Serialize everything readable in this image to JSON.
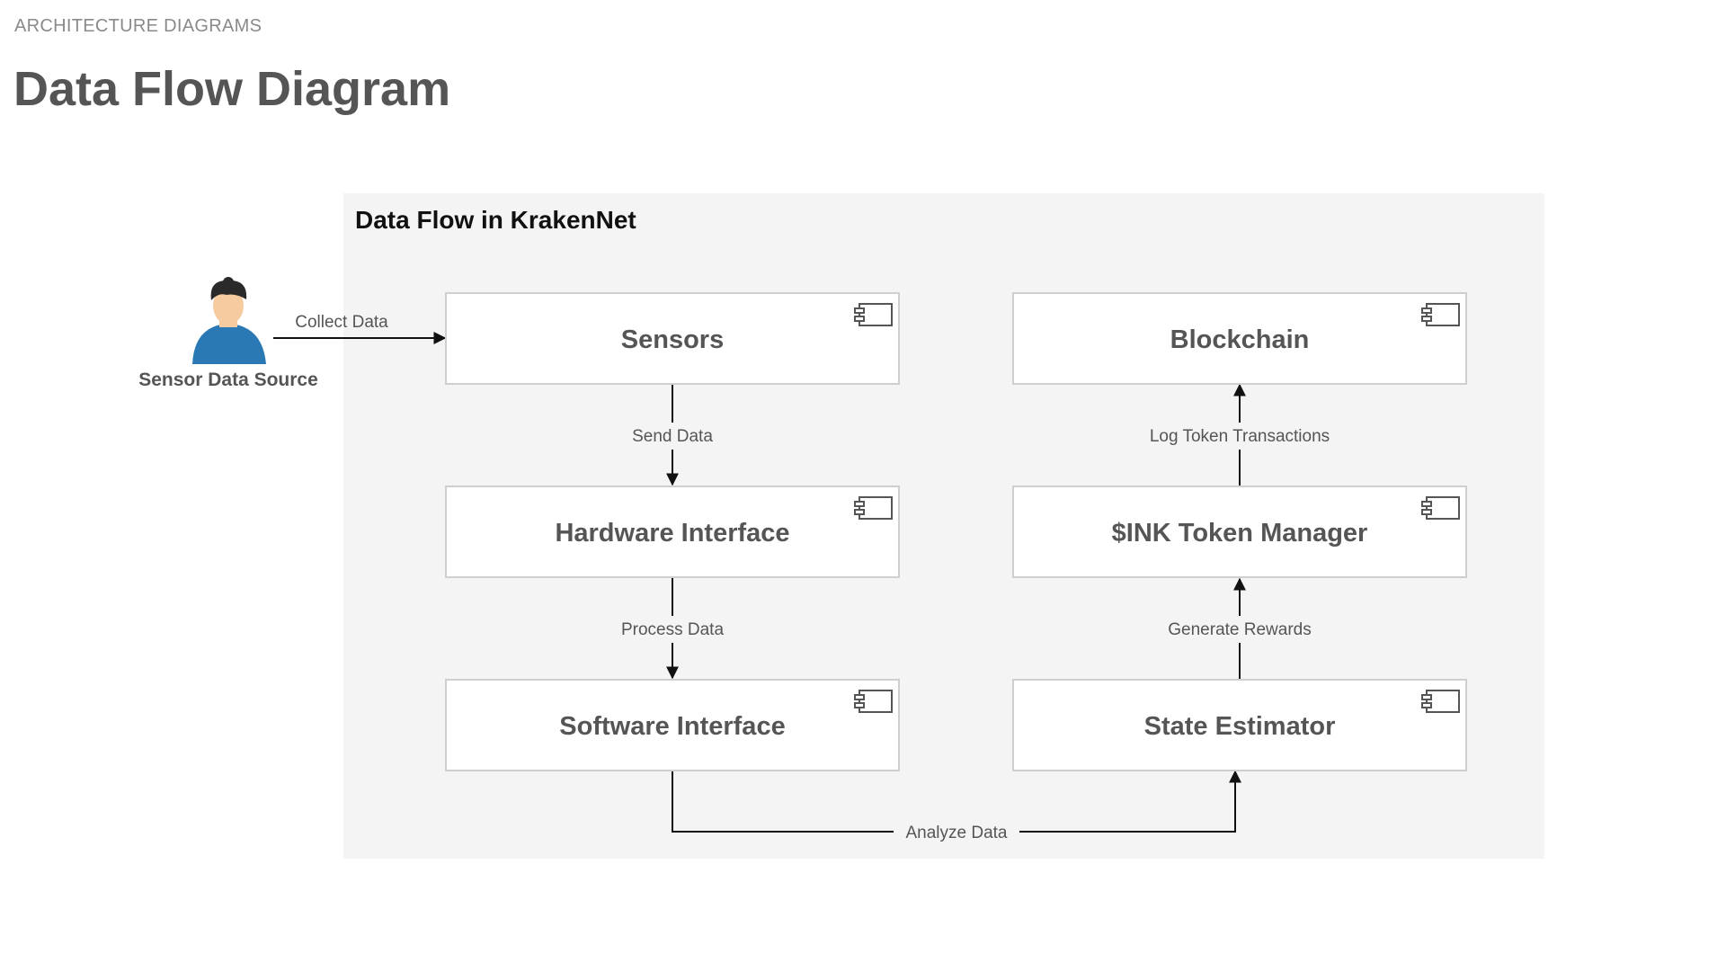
{
  "header": {
    "section_label": "ARCHITECTURE DIAGRAMS",
    "title": "Data Flow Diagram"
  },
  "diagram": {
    "group_title": "Data Flow in KrakenNet",
    "actor": {
      "label": "Sensor Data Source",
      "icon": "person-icon"
    },
    "components": {
      "sensors": "Sensors",
      "hardware_interface": "Hardware Interface",
      "software_interface": "Software Interface",
      "blockchain": "Blockchain",
      "token_manager": "$INK Token Manager",
      "state_estimator": "State Estimator"
    },
    "flows": {
      "collect_data": "Collect Data",
      "send_data": "Send Data",
      "process_data": "Process Data",
      "analyze_data": "Analyze Data",
      "generate_rewards": "Generate Rewards",
      "log_token_transactions": "Log Token Transactions"
    },
    "colors": {
      "group_background": "#f4f4f4",
      "box_border": "#cfcfcf",
      "box_fill": "#ffffff",
      "text": "#555555",
      "line": "#111111",
      "actor_shirt": "#2a79b4",
      "actor_skin": "#f7cba0",
      "actor_hair": "#2a2a2a"
    }
  }
}
